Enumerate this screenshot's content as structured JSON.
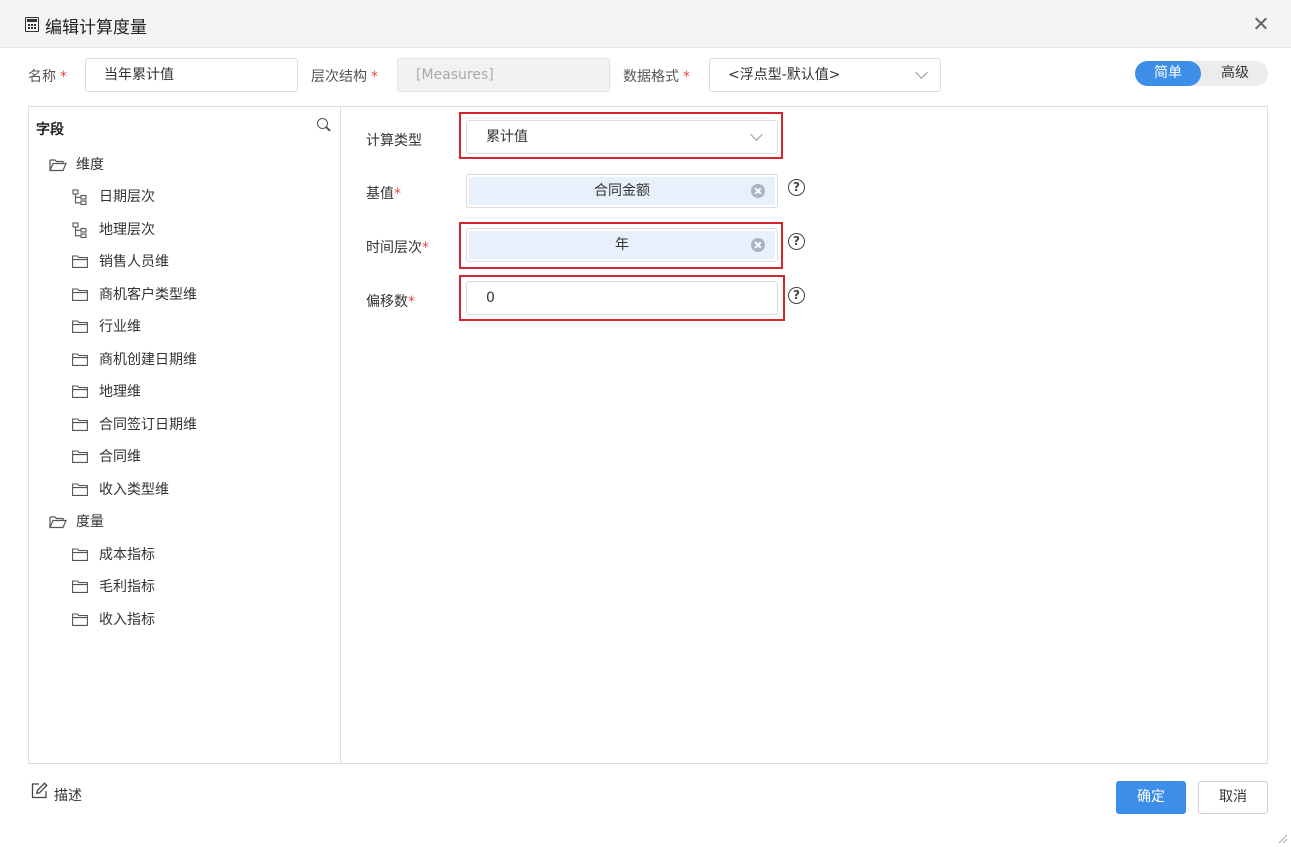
{
  "dialog": {
    "title": "编辑计算度量"
  },
  "header_form": {
    "name_label": "名称",
    "name_value": "当年累计值",
    "hierarchy_label": "层次结构",
    "hierarchy_value": "[Measures]",
    "format_label": "数据格式",
    "format_value": "<浮点型-默认值>",
    "required_mark": "*"
  },
  "mode_toggle": {
    "simple": "简单",
    "advanced": "高级",
    "selected": "简单"
  },
  "fields_panel": {
    "title": "字段",
    "groups": [
      {
        "label": "维度",
        "items": [
          {
            "label": "日期层次",
            "icon": "hierarchy-icon"
          },
          {
            "label": "地理层次",
            "icon": "hierarchy-icon"
          },
          {
            "label": "销售人员维",
            "icon": "folder-icon"
          },
          {
            "label": "商机客户类型维",
            "icon": "folder-icon"
          },
          {
            "label": "行业维",
            "icon": "folder-icon"
          },
          {
            "label": "商机创建日期维",
            "icon": "folder-icon"
          },
          {
            "label": "地理维",
            "icon": "folder-icon"
          },
          {
            "label": "合同签订日期维",
            "icon": "folder-icon"
          },
          {
            "label": "合同维",
            "icon": "folder-icon"
          },
          {
            "label": "收入类型维",
            "icon": "folder-icon"
          }
        ]
      },
      {
        "label": "度量",
        "items": [
          {
            "label": "成本指标",
            "icon": "folder-icon"
          },
          {
            "label": "毛利指标",
            "icon": "folder-icon"
          },
          {
            "label": "收入指标",
            "icon": "folder-icon"
          }
        ]
      }
    ]
  },
  "calc_form": {
    "calc_type_label": "计算类型",
    "calc_type_value": "累计值",
    "base_label": "基值",
    "base_value": "合同金额",
    "time_level_label": "时间层次",
    "time_level_value": "年",
    "offset_label": "偏移数",
    "offset_value": "0",
    "help_glyph": "?"
  },
  "footer": {
    "description": "描述",
    "ok": "确定",
    "cancel": "取消"
  },
  "colors": {
    "accent": "#3c8ee8",
    "highlight": "#d9232d",
    "required": "#e64646",
    "chip_bg": "#e8f0fb"
  }
}
